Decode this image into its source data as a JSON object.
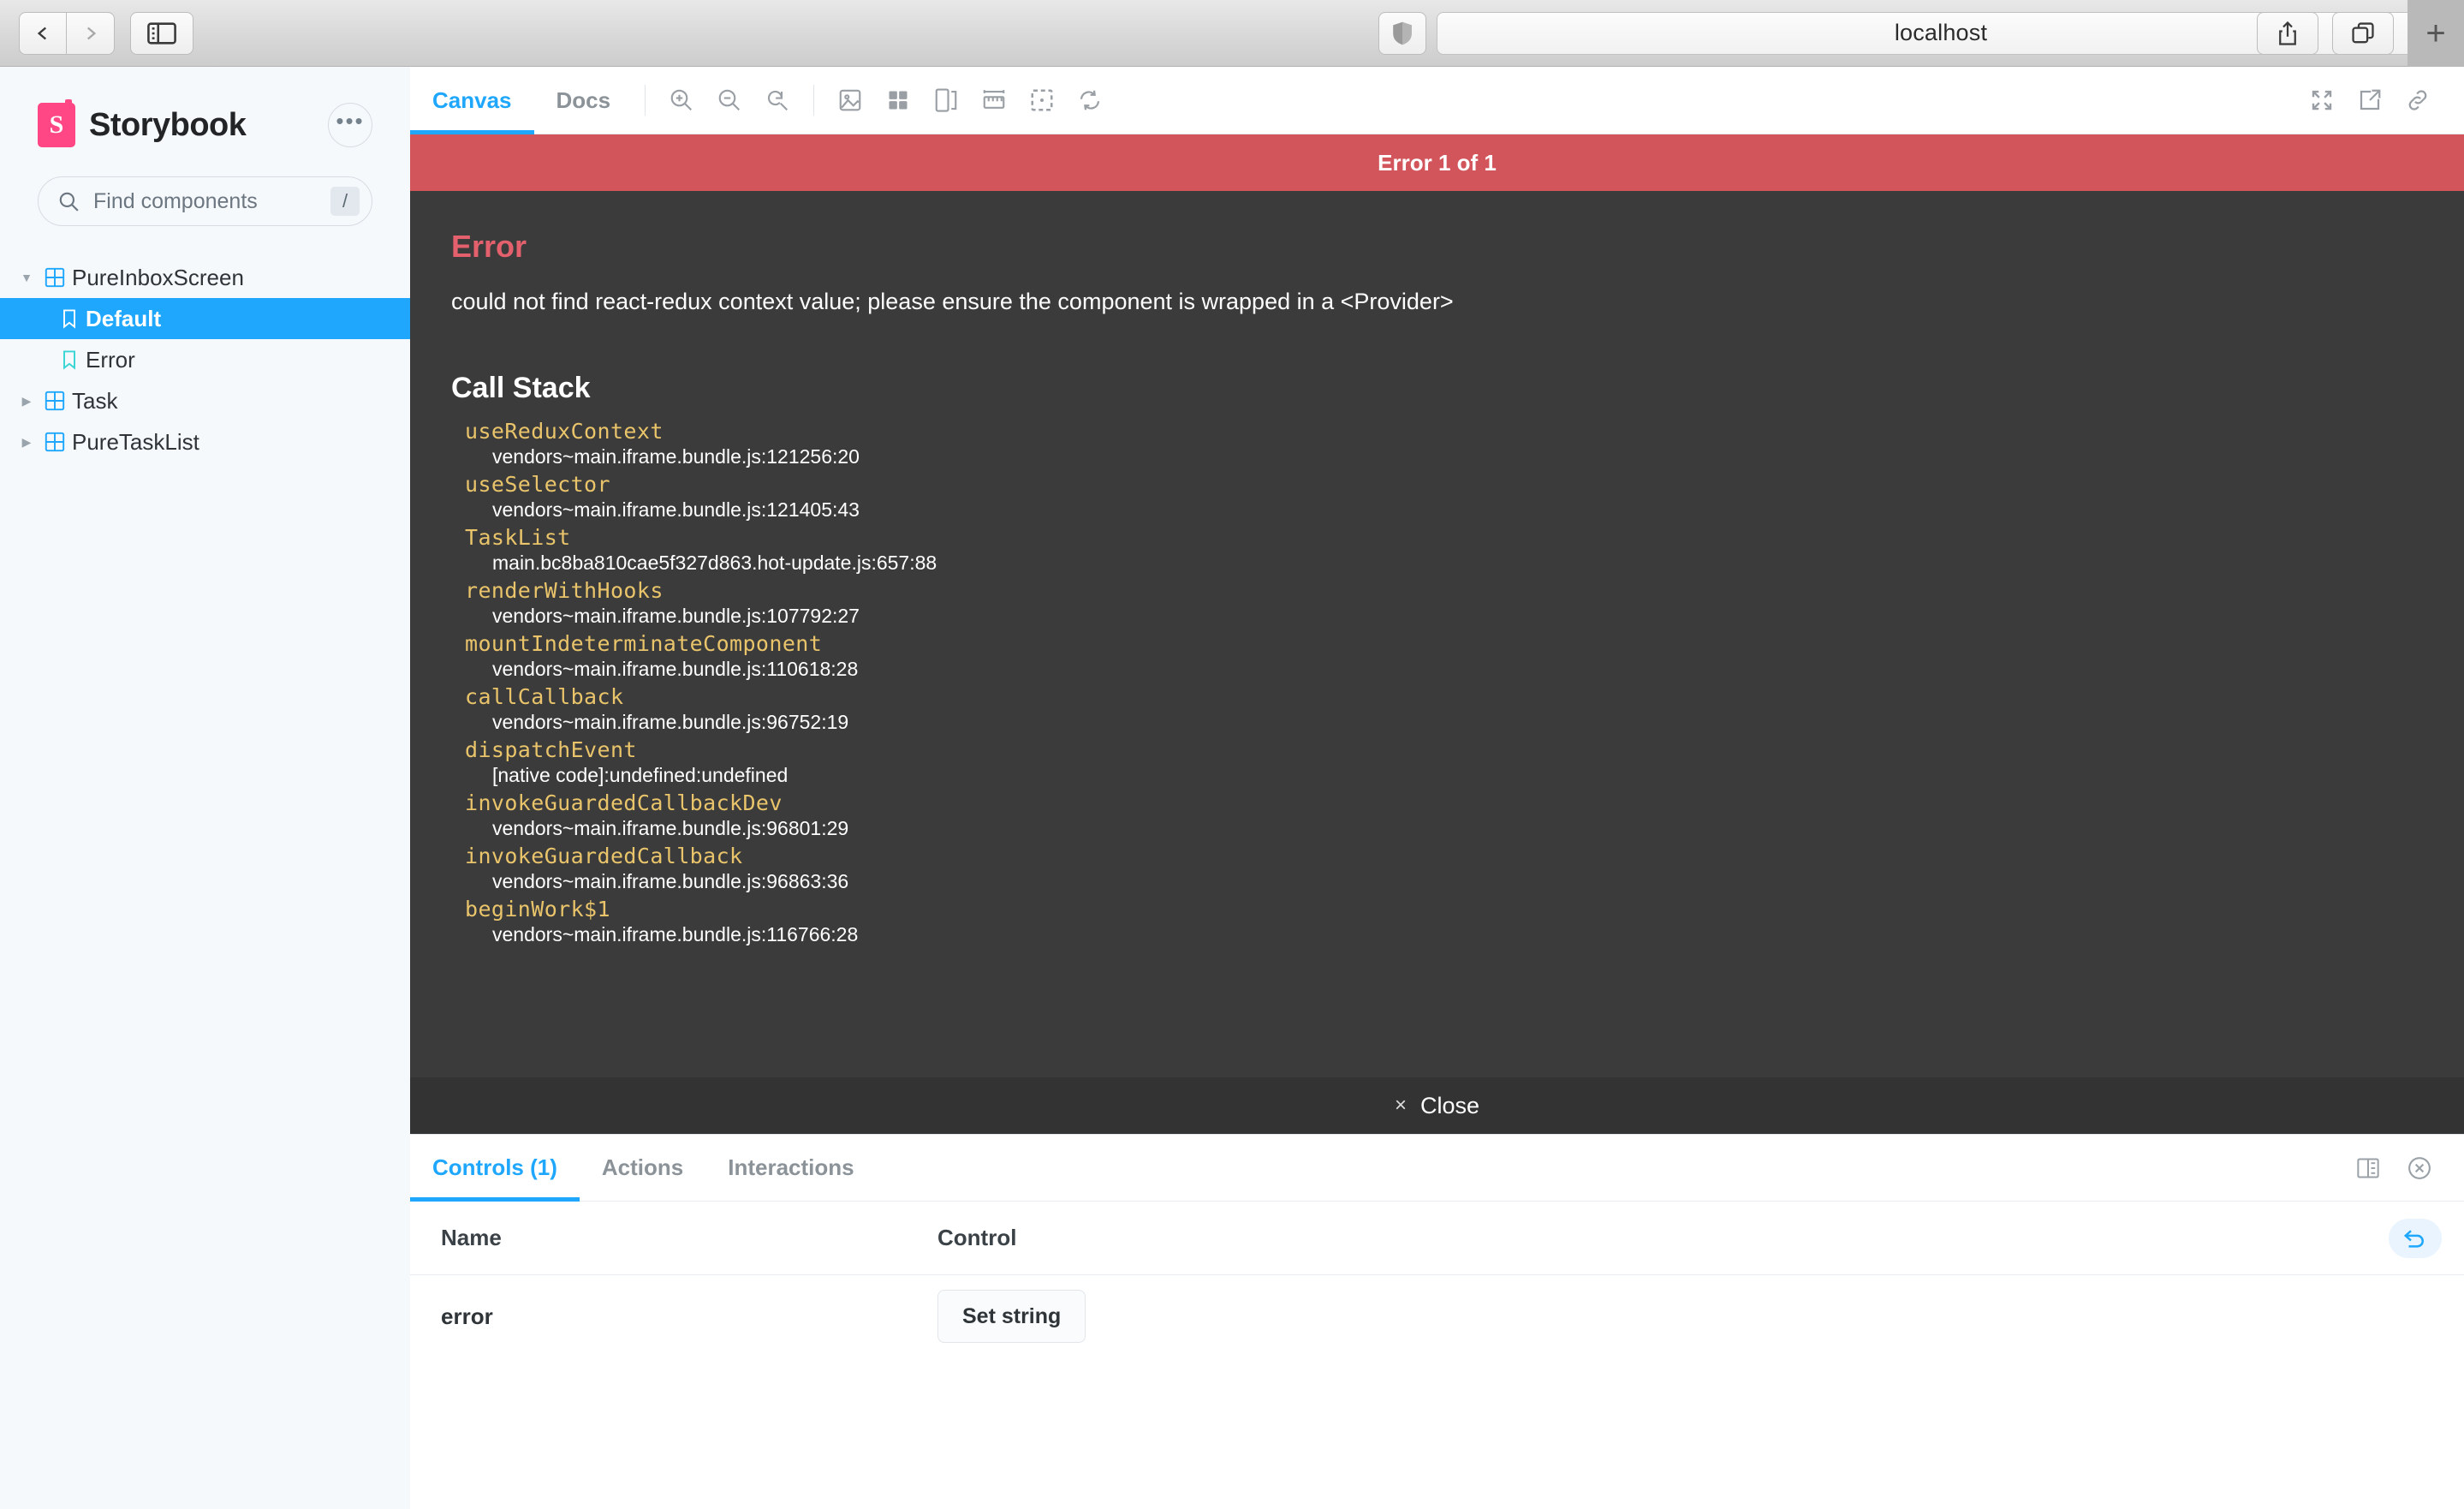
{
  "browser": {
    "back_icon": "chevron-left-icon",
    "forward_icon": "chevron-right-icon",
    "sidebar_icon": "sidebar-toggle-icon",
    "shield_icon": "privacy-shield-icon",
    "url": "localhost",
    "reload_icon": "reload-icon",
    "share_icon": "share-icon",
    "tabs_icon": "tab-overview-icon",
    "newtab_label": "+"
  },
  "sidebar": {
    "logo_letter": "S",
    "brand": "Storybook",
    "menu_icon": "ellipsis-icon",
    "search": {
      "placeholder": "Find components",
      "icon": "search-icon",
      "shortcut": "/"
    },
    "tree": [
      {
        "label": "PureInboxScreen",
        "type": "component",
        "depth": 0,
        "expanded": true,
        "selected": false
      },
      {
        "label": "Default",
        "type": "story",
        "depth": 1,
        "selected": true
      },
      {
        "label": "Error",
        "type": "story",
        "depth": 1,
        "selected": false
      },
      {
        "label": "Task",
        "type": "component",
        "depth": 0,
        "expanded": false,
        "selected": false
      },
      {
        "label": "PureTaskList",
        "type": "component",
        "depth": 0,
        "expanded": false,
        "selected": false
      }
    ]
  },
  "toolbar": {
    "tabs": [
      {
        "label": "Canvas",
        "active": true
      },
      {
        "label": "Docs",
        "active": false
      }
    ],
    "icons": [
      "zoom-in-icon",
      "zoom-out-icon",
      "zoom-reset-icon",
      "backgrounds-icon",
      "grid-icon",
      "outline-icon",
      "measure-icon",
      "focus-outline-icon",
      "remount-icon"
    ],
    "right_icons": [
      "fullscreen-icon",
      "open-new-tab-icon",
      "copy-link-icon"
    ]
  },
  "error": {
    "banner": "Error 1 of 1",
    "title": "Error",
    "message": "could not find react-redux context value; please ensure the component is wrapped in a <Provider>",
    "call_stack_title": "Call Stack",
    "frames": [
      {
        "fn": "useReduxContext",
        "loc": "vendors~main.iframe.bundle.js:121256:20"
      },
      {
        "fn": "useSelector",
        "loc": "vendors~main.iframe.bundle.js:121405:43"
      },
      {
        "fn": "TaskList",
        "loc": "main.bc8ba810cae5f327d863.hot-update.js:657:88"
      },
      {
        "fn": "renderWithHooks",
        "loc": "vendors~main.iframe.bundle.js:107792:27"
      },
      {
        "fn": "mountIndeterminateComponent",
        "loc": "vendors~main.iframe.bundle.js:110618:28"
      },
      {
        "fn": "callCallback",
        "loc": "vendors~main.iframe.bundle.js:96752:19"
      },
      {
        "fn": "dispatchEvent",
        "loc": "[native code]:undefined:undefined"
      },
      {
        "fn": "invokeGuardedCallbackDev",
        "loc": "vendors~main.iframe.bundle.js:96801:29"
      },
      {
        "fn": "invokeGuardedCallback",
        "loc": "vendors~main.iframe.bundle.js:96863:36"
      },
      {
        "fn": "beginWork$1",
        "loc": "vendors~main.iframe.bundle.js:116766:28"
      }
    ],
    "close_label": "Close",
    "close_icon": "close-x-icon"
  },
  "panel": {
    "tabs": [
      {
        "label": "Controls (1)",
        "active": true
      },
      {
        "label": "Actions",
        "active": false
      },
      {
        "label": "Interactions",
        "active": false
      }
    ],
    "layout_icon": "panel-position-icon",
    "close_icon": "close-circle-icon",
    "table": {
      "columns": [
        "Name",
        "Control"
      ],
      "reset_icon": "undo-icon",
      "rows": [
        {
          "name": "error",
          "control_label": "Set string"
        }
      ]
    }
  },
  "colors": {
    "accent": "#1ea7fd",
    "brand": "#ff4785",
    "error_banner": "#d2555c",
    "error_title": "#e4606d",
    "stack_fn": "#e9c46a",
    "panel_bg": "#3b3b3b"
  }
}
